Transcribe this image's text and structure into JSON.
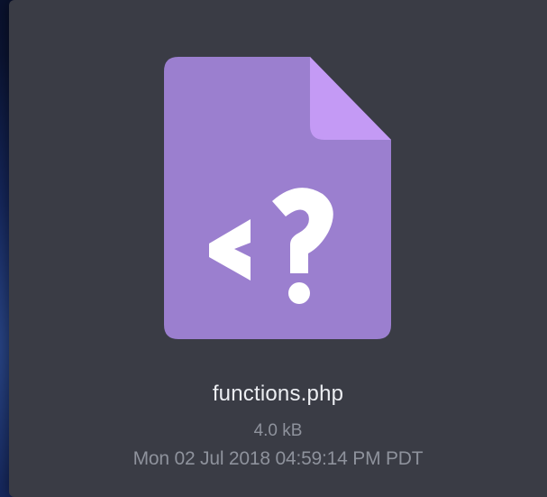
{
  "file": {
    "name": "functions.php",
    "size": "4.0 kB",
    "modified": "Mon 02 Jul 2018 04:59:14 PM PDT",
    "icon": "php-file-icon"
  },
  "colors": {
    "icon_body": "#9b7fcf",
    "icon_fold": "#c49af5",
    "icon_glyph": "#ffffff",
    "panel_bg": "#3a3c45",
    "name_text": "#eceef2",
    "meta_text": "#8e929c"
  }
}
